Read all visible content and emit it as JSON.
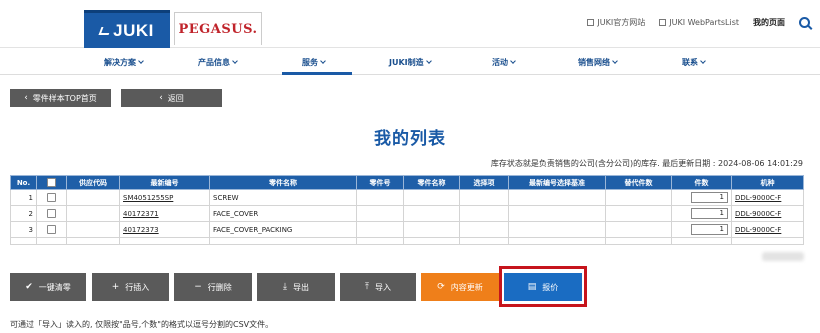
{
  "header": {
    "logo_juki": "JUKI",
    "logo_pegasus": "PEGASUS.",
    "links": [
      "JUKI官方网站",
      "JUKI WebPartsList"
    ],
    "my_page": "我的页面"
  },
  "nav": {
    "items": [
      "解决方案",
      "产品信息",
      "服务",
      "JUKI制造",
      "活动",
      "销售网络",
      "联系"
    ],
    "active": "服务"
  },
  "top_buttons": {
    "back_to_top": "零件样本TOP首页",
    "back": "返回"
  },
  "page_title": "我的列表",
  "stock_note": "库存状态就是负责销售的公司(含分公司)的库存. 最后更新日期 : 2024-08-06 14:01:29",
  "table": {
    "headers": [
      "No.",
      "",
      "供应代码",
      "最新编号",
      "零件名称",
      "零件号",
      "零件名称",
      "选择项",
      "最新编号选择基准",
      "替代件数",
      "件数",
      "机种"
    ],
    "rows": [
      {
        "no": "1",
        "supply": "",
        "latest": "SM4051255SP",
        "name": "SCREW",
        "part_no": "",
        "part_name": "",
        "option": "",
        "basis": "",
        "alt": "",
        "qty": "1",
        "model": "DDL-9000C-F"
      },
      {
        "no": "2",
        "supply": "",
        "latest": "40172371",
        "name": "FACE_COVER",
        "part_no": "",
        "part_name": "",
        "option": "",
        "basis": "",
        "alt": "",
        "qty": "1",
        "model": "DDL-9000C-F"
      },
      {
        "no": "3",
        "supply": "",
        "latest": "40172373",
        "name": "FACE_COVER_PACKING",
        "part_no": "",
        "part_name": "",
        "option": "",
        "basis": "",
        "alt": "",
        "qty": "1",
        "model": "DDL-9000C-F"
      }
    ]
  },
  "actions": {
    "clear_all": "一键清零",
    "insert_row": "行插入",
    "delete_row": "行删除",
    "export": "导出",
    "import": "导入",
    "update": "内容更新",
    "quote": "报价"
  },
  "bottom_note": "可通过「导入」读入的, 仅限按\"品号,个数\"的格式以逗号分割的CSV文件。",
  "colors": {
    "brand_blue": "#1a5aa6",
    "table_header": "#1f5fa8",
    "button_gray": "#5a5a5a",
    "button_orange": "#ef7f1a",
    "button_blue": "#1a6cc2",
    "highlight_red": "#c6141c"
  }
}
